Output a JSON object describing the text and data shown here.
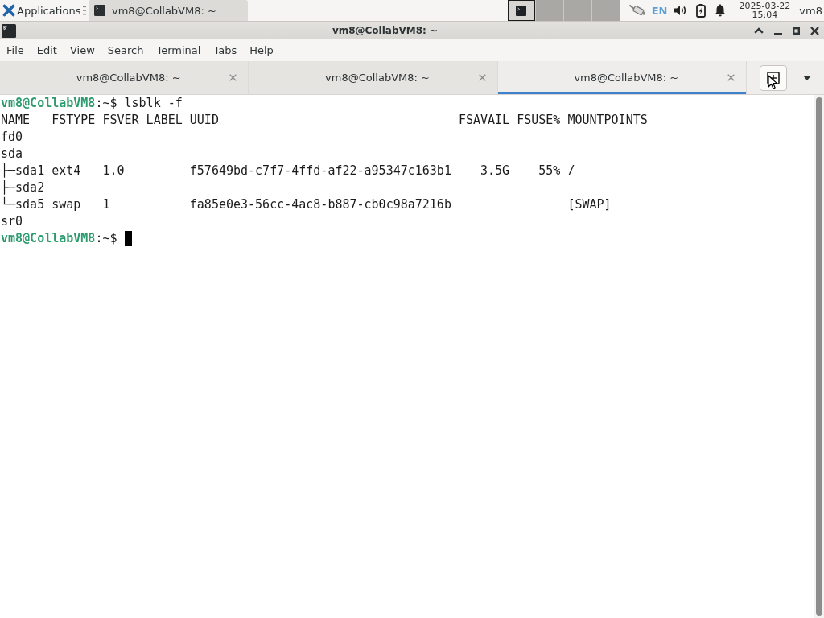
{
  "top_panel": {
    "applications_label": "Applications",
    "task_buttons": [
      {
        "label": "vm8@CollabVM8: ~",
        "selected": true
      }
    ],
    "workspaces": [
      {
        "selected": true,
        "has_window": true
      },
      {
        "selected": false,
        "has_window": false
      },
      {
        "selected": false,
        "has_window": false
      },
      {
        "selected": false,
        "has_window": false
      }
    ],
    "keyboard_layout": "EN",
    "clock": {
      "date": "2025-03-22",
      "time": "15:04"
    },
    "user": "vm8"
  },
  "window": {
    "title": "vm8@CollabVM8: ~"
  },
  "menu": [
    "File",
    "Edit",
    "View",
    "Search",
    "Terminal",
    "Tabs",
    "Help"
  ],
  "tabs": [
    {
      "label": "vm8@CollabVM8: ~",
      "selected": false
    },
    {
      "label": "vm8@CollabVM8: ~",
      "selected": false
    },
    {
      "label": "vm8@CollabVM8: ~",
      "selected": true
    }
  ],
  "terminal": {
    "lines": [
      {
        "kind": "prompt",
        "user_host": "vm8@CollabVM8",
        "path": ":~$",
        "command": "lsblk -f",
        "cursor": false
      },
      {
        "kind": "output",
        "text": "NAME   FSTYPE FSVER LABEL UUID                                 FSAVAIL FSUSE% MOUNTPOINTS"
      },
      {
        "kind": "output",
        "text": "fd0"
      },
      {
        "kind": "output",
        "text": "sda"
      },
      {
        "kind": "output",
        "text": "├─sda1 ext4   1.0         f57649bd-c7f7-4ffd-af22-a95347c163b1    3.5G    55% /"
      },
      {
        "kind": "output",
        "text": "├─sda2"
      },
      {
        "kind": "output",
        "text": "└─sda5 swap   1           fa85e0e3-56cc-4ac8-b887-cb0c98a7216b                [SWAP]"
      },
      {
        "kind": "output",
        "text": "sr0"
      },
      {
        "kind": "prompt",
        "user_host": "vm8@CollabVM8",
        "path": ":~$",
        "cursor": true
      }
    ]
  }
}
